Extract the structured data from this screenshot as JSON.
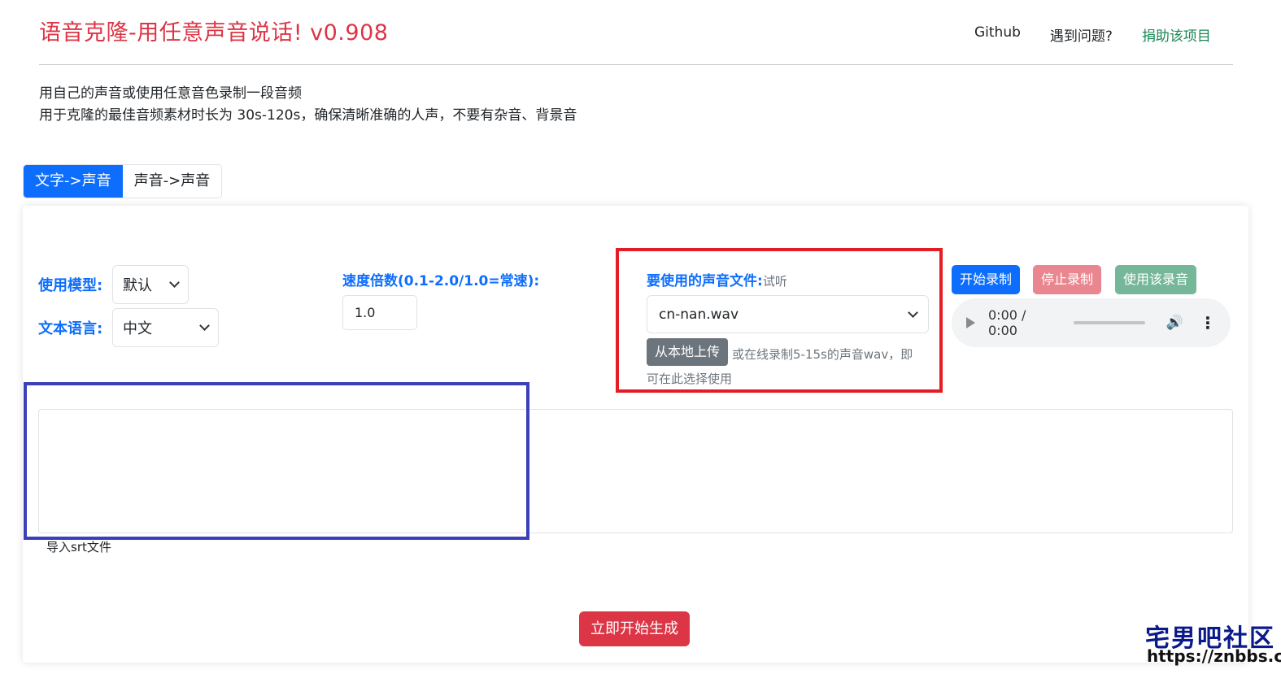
{
  "header": {
    "title": "语音克隆-用任意声音说话! v0.908",
    "nav": [
      "Github",
      "遇到问题?",
      "捐助该项目"
    ]
  },
  "intro": {
    "line1": "用自己的声音或使用任意音色录制一段音频",
    "line2": "用于克隆的最佳音频素材时长为 30s-120s，确保清晰准确的人声，不要有杂音、背景音"
  },
  "tabs": [
    "文字->声音",
    "声音->声音"
  ],
  "form": {
    "model_label": "使用模型:",
    "model_value": "默认",
    "language_label": "文本语言:",
    "language_value": "中文",
    "speed_label": "速度倍数(0.1-2.0/1.0=常速):",
    "speed_value": "1.0",
    "voice_label": "要使用的声音文件:",
    "voice_preview": "试听",
    "voice_value": "cn-nan.wav",
    "upload_button": "从本地上传",
    "upload_hint": "或在线录制5-15s的声音wav，即可在此选择使用",
    "record_button": "开始录制",
    "stop_button": "停止录制",
    "use_button": "使用该录音",
    "audio_time": "0:00 / 0:00",
    "srt_label": "导入srt文件",
    "generate_button": "立即开始生成"
  },
  "watermark": {
    "title": "宅男吧社区",
    "url": "https://znbbs.cc/"
  },
  "colors": {
    "primary": "#0d6efd",
    "danger": "#dc3545",
    "annotation_red": "#e31c25",
    "annotation_blue": "#3b40b8"
  }
}
